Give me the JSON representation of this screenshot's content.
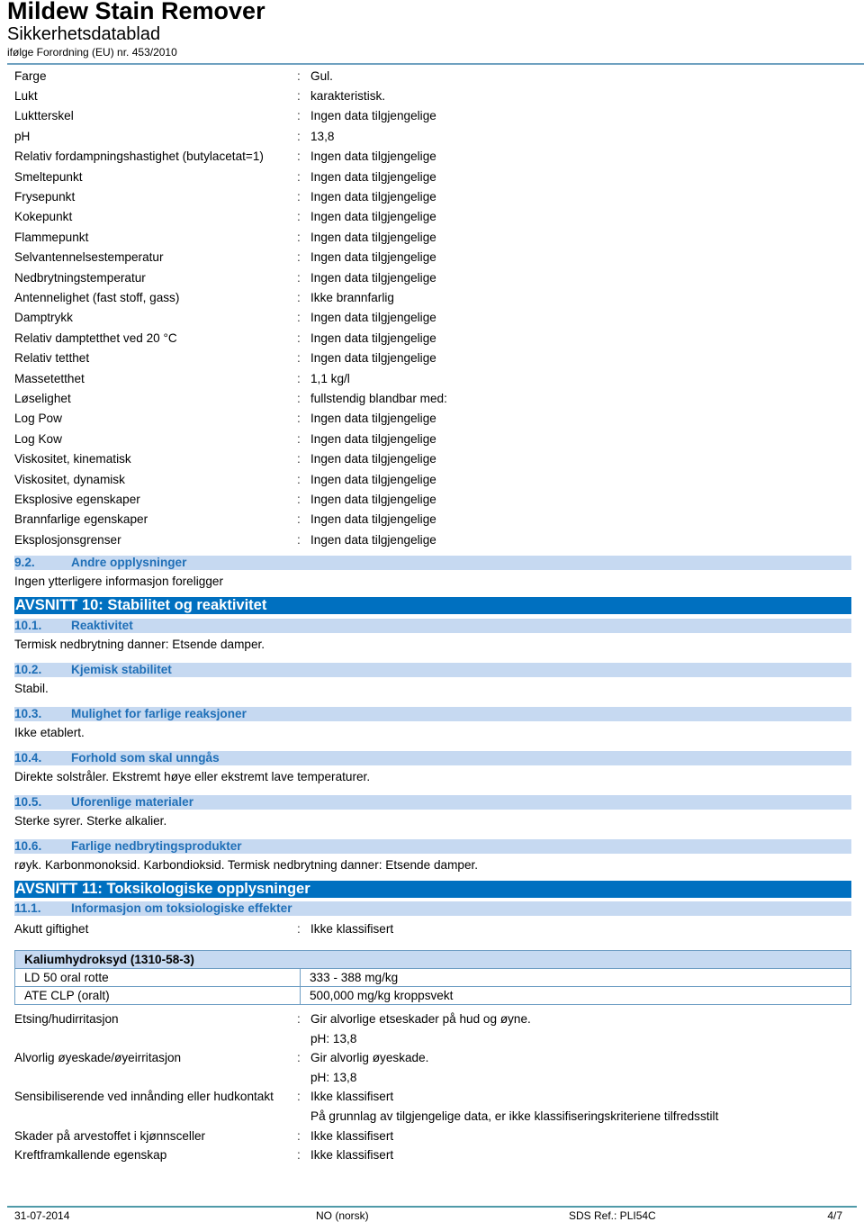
{
  "header": {
    "title": "Mildew Stain Remover",
    "subtitle": "Sikkerhetsdatablad",
    "regulation": "ifølge Forordning (EU) nr. 453/2010"
  },
  "properties": [
    {
      "label": "Farge",
      "value": "Gul."
    },
    {
      "label": "Lukt",
      "value": "karakteristisk."
    },
    {
      "label": "Luktterskel",
      "value": "Ingen data tilgjengelige"
    },
    {
      "label": "pH",
      "value": "13,8"
    },
    {
      "label": "Relativ fordampningshastighet (butylacetat=1)",
      "value": "Ingen data tilgjengelige"
    },
    {
      "label": "Smeltepunkt",
      "value": "Ingen data tilgjengelige"
    },
    {
      "label": "Frysepunkt",
      "value": "Ingen data tilgjengelige"
    },
    {
      "label": "Kokepunkt",
      "value": "Ingen data tilgjengelige"
    },
    {
      "label": "Flammepunkt",
      "value": "Ingen data tilgjengelige"
    },
    {
      "label": "Selvantennelsestemperatur",
      "value": "Ingen data tilgjengelige"
    },
    {
      "label": "Nedbrytningstemperatur",
      "value": "Ingen data tilgjengelige"
    },
    {
      "label": "Antennelighet (fast stoff, gass)",
      "value": "Ikke brannfarlig"
    },
    {
      "label": "Damptrykk",
      "value": "Ingen data tilgjengelige"
    },
    {
      "label": "Relativ damptetthet ved 20 °C",
      "value": "Ingen data tilgjengelige"
    },
    {
      "label": "Relativ tetthet",
      "value": "Ingen data tilgjengelige"
    },
    {
      "label": "Massetetthet",
      "value": "1,1 kg/l"
    },
    {
      "label": "Løselighet",
      "value": "fullstendig blandbar med:"
    },
    {
      "label": "Log Pow",
      "value": "Ingen data tilgjengelige"
    },
    {
      "label": "Log Kow",
      "value": "Ingen data tilgjengelige"
    },
    {
      "label": "Viskositet, kinematisk",
      "value": "Ingen data tilgjengelige"
    },
    {
      "label": "Viskositet, dynamisk",
      "value": "Ingen data tilgjengelige"
    },
    {
      "label": "Eksplosive egenskaper",
      "value": "Ingen data tilgjengelige"
    },
    {
      "label": "Brannfarlige egenskaper",
      "value": "Ingen data tilgjengelige"
    },
    {
      "label": "Eksplosjonsgrenser",
      "value": "Ingen data tilgjengelige"
    }
  ],
  "s92": {
    "num": "9.2.",
    "title": "Andre opplysninger",
    "text": "Ingen ytterligere informasjon foreligger"
  },
  "section10": {
    "title": "AVSNITT 10: Stabilitet og reaktivitet",
    "subs": [
      {
        "num": "10.1.",
        "title": "Reaktivitet",
        "text": "Termisk nedbrytning danner: Etsende damper."
      },
      {
        "num": "10.2.",
        "title": "Kjemisk stabilitet",
        "text": "Stabil."
      },
      {
        "num": "10.3.",
        "title": "Mulighet for farlige reaksjoner",
        "text": "Ikke etablert."
      },
      {
        "num": "10.4.",
        "title": "Forhold som skal unngås",
        "text": "Direkte solstråler. Ekstremt høye eller ekstremt lave temperaturer."
      },
      {
        "num": "10.5.",
        "title": "Uforenlige materialer",
        "text": "Sterke syrer. Sterke alkalier."
      },
      {
        "num": "10.6.",
        "title": "Farlige nedbrytingsprodukter",
        "text": "røyk. Karbonmonoksid. Karbondioksid. Termisk nedbrytning danner: Etsende damper."
      }
    ]
  },
  "section11": {
    "title": "AVSNITT 11: Toksikologiske opplysninger",
    "sub_num": "11.1.",
    "sub_title": "Informasjon om toksiologiske effekter",
    "acute_label": "Akutt giftighet",
    "acute_value": "Ikke klassifisert",
    "table": {
      "header": "Kaliumhydroksyd (1310-58-3)",
      "rows": [
        {
          "key": "LD 50 oral rotte",
          "value": "333 - 388 mg/kg"
        },
        {
          "key": "ATE CLP (oralt)",
          "value": "500,000 mg/kg kroppsvekt"
        }
      ]
    },
    "effects": [
      {
        "label": "Etsing/hudirritasjon",
        "values": [
          "Gir alvorlige etseskader på hud og øyne.",
          "pH: 13,8"
        ]
      },
      {
        "label": "Alvorlig øyeskade/øyeirritasjon",
        "values": [
          "Gir alvorlig øyeskade.",
          "pH: 13,8"
        ]
      },
      {
        "label": "Sensibiliserende ved innånding eller hudkontakt",
        "values": [
          "Ikke klassifisert",
          "På grunnlag av tilgjengelige data, er ikke klassifiseringskriteriene tilfredsstilt"
        ]
      },
      {
        "label": "Skader på arvestoffet i kjønnsceller",
        "values": [
          "Ikke klassifisert"
        ]
      },
      {
        "label": "Kreftframkallende egenskap",
        "values": [
          "Ikke klassifisert"
        ]
      }
    ]
  },
  "footer": {
    "date": "31-07-2014",
    "language": "NO (norsk)",
    "ref": "SDS Ref.: PLI54C",
    "page": "4/7"
  },
  "colon": ":",
  "colors": {
    "section_bg": "#0070c0",
    "subsection_bg": "#c6d9f1",
    "subsection_text": "#1f6fb7"
  }
}
